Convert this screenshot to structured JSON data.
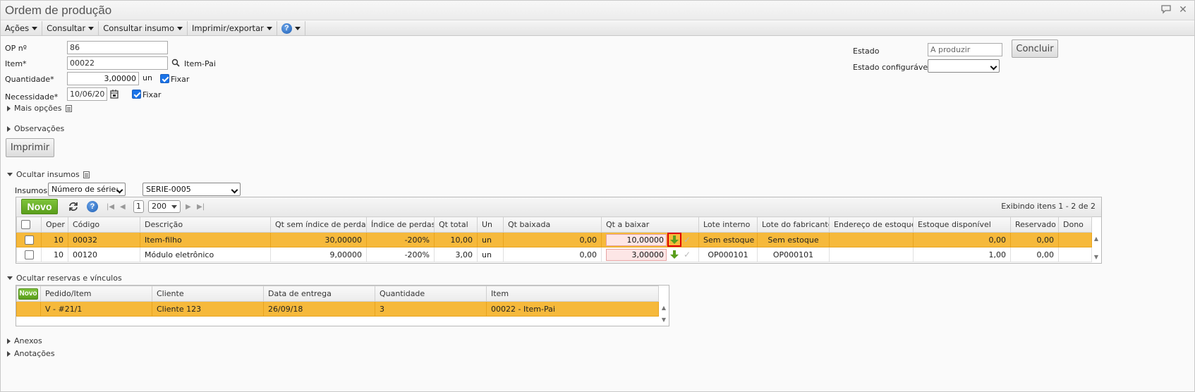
{
  "window": {
    "title": "Ordem de produção"
  },
  "menubar": {
    "items": [
      {
        "label": "Ações"
      },
      {
        "label": "Consultar"
      },
      {
        "label": "Consultar insumo"
      },
      {
        "label": "Imprimir/exportar"
      }
    ],
    "help": "?"
  },
  "form": {
    "op_label": "OP nº",
    "op_value": "86",
    "item_label": "Item*",
    "item_value": "00022",
    "item_desc": "Item-Pai",
    "qty_label": "Quantidade*",
    "qty_value": "3,00000",
    "qty_unit": "un",
    "qty_fix_label": "Fixar",
    "need_label": "Necessidade*",
    "need_value": "10/06/20",
    "need_fix_label": "Fixar",
    "more_options": "Mais opções",
    "observations": "Observações",
    "print_button": "Imprimir",
    "state_label": "Estado",
    "state_value": "A produzir",
    "config_state_label": "Estado configurável",
    "config_state_value": "",
    "conclude_button": "Concluir"
  },
  "insumos": {
    "section_label": "Ocultar insumos",
    "filter_label": "Insumos",
    "filter_type": "Número de série:",
    "filter_value": "SERIE-0005",
    "new_button": "Novo",
    "page": "1",
    "page_size": "200",
    "showing": "Exibindo itens 1 - 2 de 2",
    "columns": [
      "",
      "Oper",
      "Código",
      "Descrição",
      "Qt sem índice de perdas",
      "Índice de perdas",
      "Qt total",
      "Un",
      "Qt baixada",
      "Qt a baixar",
      "Lote interno",
      "Lote do fabricante",
      "Endereço de estoque",
      "Estoque disponível",
      "Reservado",
      "Dono"
    ],
    "rows": [
      {
        "oper": "10",
        "code": "00032",
        "desc": "Item-filho",
        "qt_sem": "30,00000",
        "indice": "-200%",
        "qt_total": "10,00",
        "un": "un",
        "qt_baixada": "0,00",
        "qt_a_baixar": "10,00000",
        "lote_interno": "Sem estoque",
        "lote_fab": "Sem estoque",
        "endereco": "",
        "estoque": "0,00",
        "reservado": "0,00",
        "dono": ""
      },
      {
        "oper": "10",
        "code": "00120",
        "desc": "Módulo eletrônico",
        "qt_sem": "9,00000",
        "indice": "-200%",
        "qt_total": "3,00",
        "un": "un",
        "qt_baixada": "0,00",
        "qt_a_baixar": "3,00000",
        "lote_interno": "OP000101",
        "lote_fab": "OP000101",
        "endereco": "",
        "estoque": "1,00",
        "reservado": "0,00",
        "dono": ""
      }
    ]
  },
  "reservas": {
    "section_label": "Ocultar reservas e vínculos",
    "new_button": "Novo",
    "columns": [
      "Pedido/Item",
      "Cliente",
      "Data de entrega",
      "Quantidade",
      "Item"
    ],
    "rows": [
      {
        "pedido": "V - #21/1",
        "cliente": "Cliente 123",
        "data": "26/09/18",
        "quantidade": "3",
        "item": "00022 - Item-Pai"
      }
    ]
  },
  "footer": {
    "anexos": "Anexos",
    "anotacoes": "Anotações"
  }
}
